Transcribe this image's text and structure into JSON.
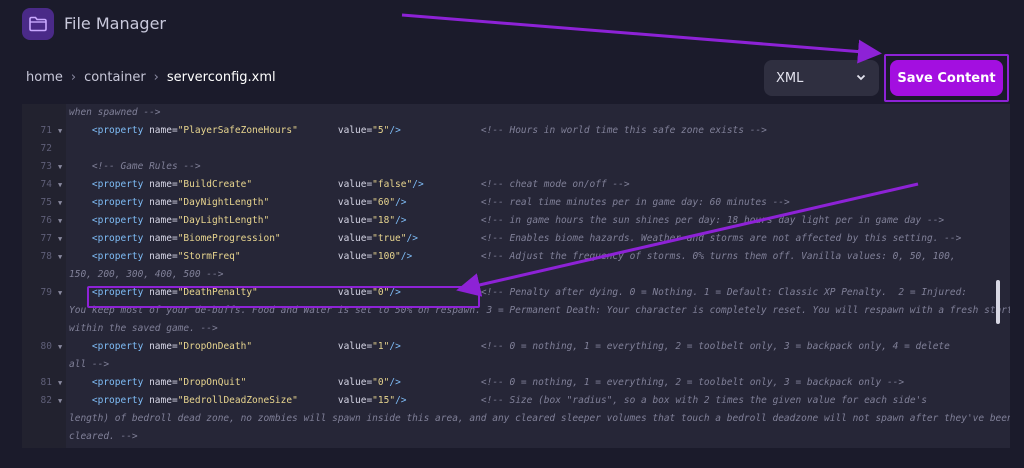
{
  "app": {
    "title": "File Manager",
    "icon": "folder-icon"
  },
  "breadcrumb": {
    "items": [
      "home",
      "container",
      "serverconfig.xml"
    ]
  },
  "format_select": {
    "value": "XML"
  },
  "save_button": {
    "label": "Save Content"
  },
  "colors": {
    "accent": "#a30fe0",
    "annotation": "#8d22d6",
    "background": "#1b1b2b",
    "editor": "#262637"
  },
  "editor": {
    "lines": [
      {
        "num": "",
        "fold": false,
        "text": "when spawned -->"
      },
      {
        "num": "71",
        "fold": true,
        "prop": "PlayerSafeZoneHours",
        "value": "5",
        "comment": "<!-- Hours in world time this safe zone exists -->"
      },
      {
        "num": "72",
        "fold": false,
        "text": ""
      },
      {
        "num": "73",
        "fold": true,
        "text": "<!-- Game Rules -->"
      },
      {
        "num": "74",
        "fold": true,
        "prop": "BuildCreate",
        "value": "false",
        "comment": "<!-- cheat mode on/off -->"
      },
      {
        "num": "75",
        "fold": true,
        "prop": "DayNightLength",
        "value": "60",
        "comment": "<!-- real time minutes per in game day: 60 minutes -->"
      },
      {
        "num": "76",
        "fold": true,
        "prop": "DayLightLength",
        "value": "18",
        "comment": "<!-- in game hours the sun shines per day: 18 hours day light per in game day -->"
      },
      {
        "num": "77",
        "fold": true,
        "prop": "BiomeProgression",
        "value": "true",
        "comment": "<!-- Enables biome hazards. Weather and storms are not affected by this setting. -->"
      },
      {
        "num": "78",
        "fold": true,
        "prop": "StormFreq",
        "value": "100",
        "comment": "<!-- Adjust the frequency of storms. 0% turns them off. Vanilla values: 0, 50, 100,"
      },
      {
        "num": "",
        "fold": false,
        "text": "150, 200, 300, 400, 500 -->"
      },
      {
        "num": "79",
        "fold": true,
        "prop": "DeathPenalty",
        "value": "0",
        "comment": "<!-- Penalty after dying. 0 = Nothing. 1 = Default: Classic XP Penalty.  2 = Injured:"
      },
      {
        "num": "",
        "fold": false,
        "text": "You keep most of your de-buffs. Food and Water is set to 50% on respawn. 3 = Permanent Death: Your character is completely reset. You will respawn with a fresh start"
      },
      {
        "num": "",
        "fold": false,
        "text": "within the saved game. -->"
      },
      {
        "num": "80",
        "fold": true,
        "prop": "DropOnDeath",
        "value": "1",
        "comment": "<!-- 0 = nothing, 1 = everything, 2 = toolbelt only, 3 = backpack only, 4 = delete"
      },
      {
        "num": "",
        "fold": false,
        "text": "all -->"
      },
      {
        "num": "81",
        "fold": true,
        "prop": "DropOnQuit",
        "value": "0",
        "comment": "<!-- 0 = nothing, 1 = everything, 2 = toolbelt only, 3 = backpack only -->"
      },
      {
        "num": "82",
        "fold": true,
        "prop": "BedrollDeadZoneSize",
        "value": "15",
        "comment": "<!-- Size (box \"radius\", so a box with 2 times the given value for each side's"
      },
      {
        "num": "",
        "fold": false,
        "text": "length) of bedroll dead zone, no zombies will spawn inside this area, and any cleared sleeper volumes that touch a bedroll deadzone will not spawn after they've been"
      },
      {
        "num": "",
        "fold": false,
        "text": "cleared. -->"
      }
    ]
  }
}
